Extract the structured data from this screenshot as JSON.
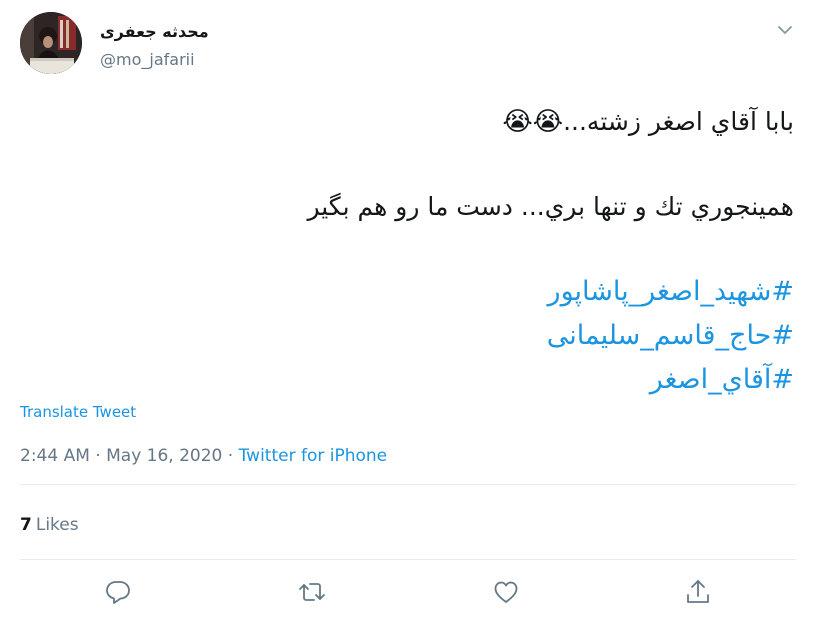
{
  "user": {
    "display_name": "محدثه جعفری",
    "handle": "@mo_jafarii"
  },
  "tweet": {
    "line1_text": "بابا آقاي اصغر زشته...",
    "line1_emoji": "😭😭",
    "line2_text": "همينجوري تك و تنها بري... دست ما رو هم بگير",
    "hashtags": [
      "#شهید_اصغر_پاشاپور",
      "#حاج_قاسم_سلیمانی",
      "#آقاي_اصغر"
    ]
  },
  "translate_label": "Translate Tweet",
  "meta": {
    "time": "2:44 AM",
    "separator": "·",
    "date": "May 16, 2020",
    "source": "Twitter for iPhone"
  },
  "likes": {
    "count": "7",
    "label": "Likes"
  },
  "actions": [
    {
      "icon": "reply-icon"
    },
    {
      "icon": "retweet-icon"
    },
    {
      "icon": "like-icon"
    },
    {
      "icon": "share-icon"
    }
  ],
  "colors": {
    "link": "#1b95e0",
    "secondary": "#657786",
    "divider": "#e6ecf0"
  }
}
